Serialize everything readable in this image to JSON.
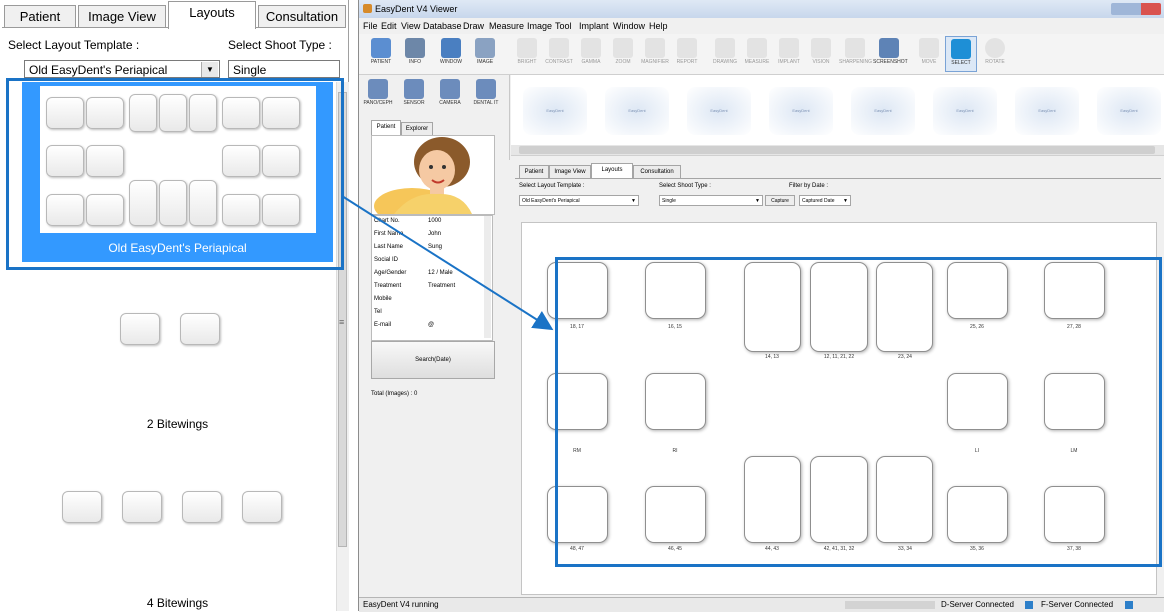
{
  "left": {
    "tabs": [
      "Patient",
      "Image View",
      "Layouts",
      "Consultation"
    ],
    "active_tab": "Layouts",
    "template_label": "Select Layout Template :",
    "shoot_label": "Select Shoot Type :",
    "template_value": "Old EasyDent's Periapical",
    "shoot_value": "Single",
    "templates": [
      {
        "name": "Old EasyDent's Periapical"
      },
      {
        "name": "2 Bitewings"
      },
      {
        "name": "4 Bitewings"
      }
    ],
    "scroll_marker": "≡"
  },
  "app": {
    "title": "EasyDent V4 Viewer",
    "menu": [
      "File",
      "Edit",
      "View",
      "Database",
      "Draw",
      "Measure",
      "Image",
      "Tool",
      "Implant",
      "Window",
      "Help"
    ],
    "toolbar": [
      "PATIENT",
      "INFO",
      "WINDOW",
      "IMAGE",
      "BRIGHT",
      "CONTRAST",
      "GAMMA",
      "ZOOM",
      "MAGNIFIER",
      "REPORT",
      "DRAWING",
      "MEASURE",
      "IMPLANT",
      "VISION",
      "SHARPENING",
      "SCREENSHOT",
      "MOVE",
      "SELECT",
      "ROTATE"
    ],
    "side_buttons": [
      "PANO/CEPH",
      "SENSOR",
      "CAMERA",
      "DENTAL IT"
    ],
    "side_tabs": [
      "Patient",
      "Explorer"
    ],
    "patient": [
      {
        "k": "Chart No.",
        "v": "1000"
      },
      {
        "k": "First Name",
        "v": "John"
      },
      {
        "k": "Last Name",
        "v": "Sung"
      },
      {
        "k": "Social ID",
        "v": ""
      },
      {
        "k": "Age/Gender",
        "v": "12 / Male"
      },
      {
        "k": "Treatment",
        "v": "Treatment"
      },
      {
        "k": "Mobile",
        "v": ""
      },
      {
        "k": "Tel",
        "v": ""
      },
      {
        "k": "E-mail",
        "v": "@"
      }
    ],
    "search_button": "Search(Date)",
    "total_images": "Total (Images) : 0",
    "thumb_text": "EasyDent",
    "main_tabs": [
      "Patient",
      "Image View",
      "Layouts",
      "Consultation"
    ],
    "main_active_tab": "Layouts",
    "template_label": "Select Layout Template :",
    "shoot_label": "Select Shoot Type :",
    "filter_label": "Filter by Date :",
    "template_value": "Old EasyDent's Periapical",
    "shoot_value": "Single",
    "capture_button": "Capture",
    "filter_value": "Captured Date",
    "tooth_labels": [
      "18, 17",
      "16, 15",
      "14, 13",
      "12, 11, 21, 22",
      "23, 24",
      "25, 26",
      "27, 28",
      "RM",
      "RI",
      "LI",
      "LM",
      "48, 47",
      "46, 45",
      "44, 43",
      "42, 41, 31, 32",
      "33, 34",
      "35, 36",
      "37, 38"
    ],
    "status_left": "EasyDent V4 running",
    "status_d": "D-Server Connected",
    "status_f": "F-Server Connected"
  },
  "colors": {
    "accent": "#3399ff",
    "highlight": "#1a73c6"
  }
}
